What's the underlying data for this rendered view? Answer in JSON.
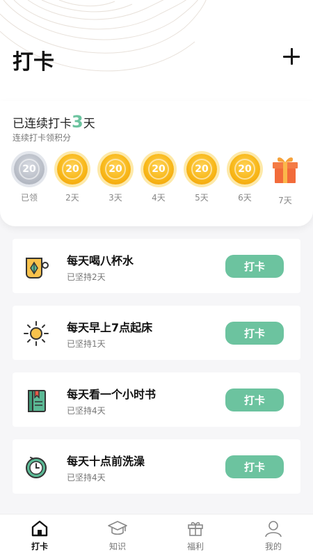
{
  "header": {
    "title": "打卡"
  },
  "streak": {
    "prefix": "已连续打卡",
    "days": "3",
    "suffix": "天",
    "subtitle": "连续打卡领积分",
    "rewards": [
      {
        "value": "20",
        "label": "已领",
        "state": "claimed"
      },
      {
        "value": "20",
        "label": "2天",
        "state": "pending"
      },
      {
        "value": "20",
        "label": "3天",
        "state": "pending"
      },
      {
        "value": "20",
        "label": "4天",
        "state": "pending"
      },
      {
        "value": "20",
        "label": "5天",
        "state": "pending"
      },
      {
        "value": "20",
        "label": "6天",
        "state": "pending"
      },
      {
        "value": "",
        "label": "7天",
        "state": "gift"
      }
    ]
  },
  "tasks": [
    {
      "title": "每天喝八杯水",
      "subtitle": "已坚持2天",
      "button": "打卡",
      "icon": "cup-icon"
    },
    {
      "title": "每天早上7点起床",
      "subtitle": "已坚持1天",
      "button": "打卡",
      "icon": "sun-icon"
    },
    {
      "title": "每天看一个小时书",
      "subtitle": "已坚持4天",
      "button": "打卡",
      "icon": "book-icon"
    },
    {
      "title": "每天十点前洗澡",
      "subtitle": "已坚持4天",
      "button": "打卡",
      "icon": "clock-icon"
    }
  ],
  "nav": [
    {
      "label": "打卡",
      "icon": "home-icon",
      "active": true
    },
    {
      "label": "知识",
      "icon": "graduation-cap-icon",
      "active": false
    },
    {
      "label": "福利",
      "icon": "gift-box-icon",
      "active": false
    },
    {
      "label": "我的",
      "icon": "user-icon",
      "active": false
    }
  ],
  "colors": {
    "accent": "#6cc39f",
    "coin": "#f8b81a",
    "gift": "#f26b3a"
  }
}
